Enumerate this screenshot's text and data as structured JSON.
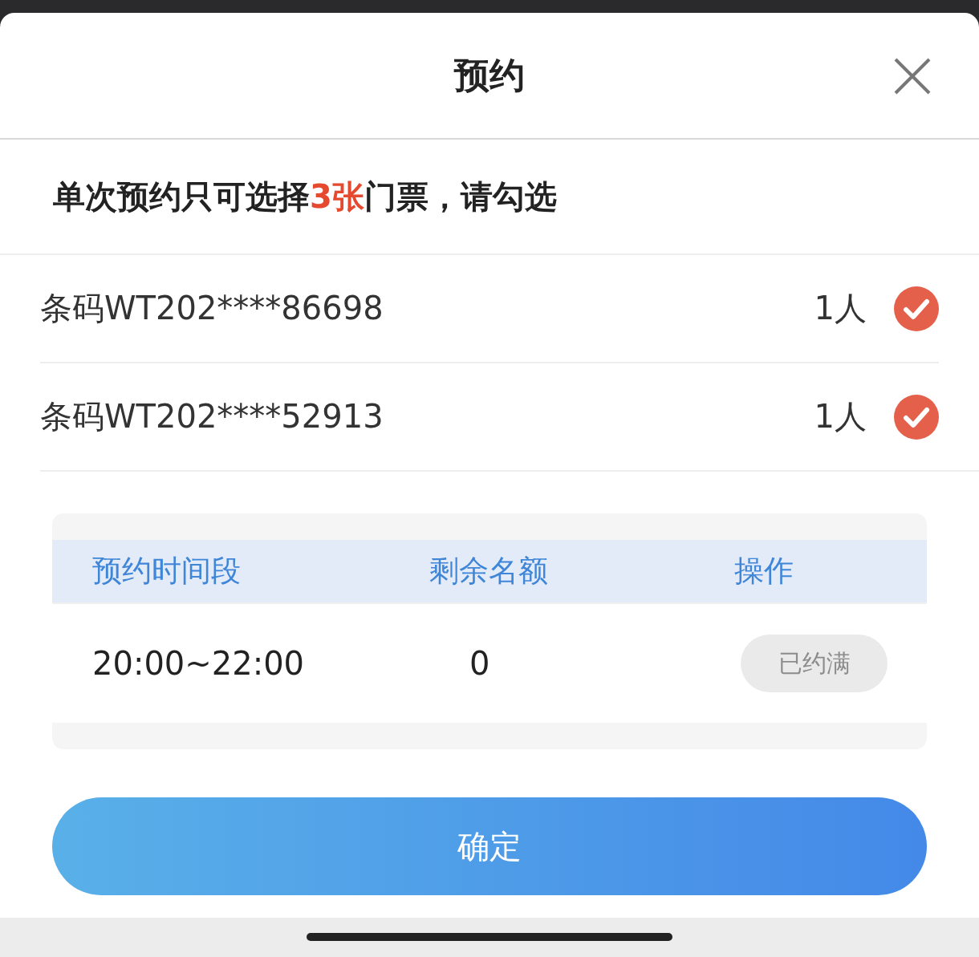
{
  "title": "预约",
  "notice": {
    "before": "单次预约只可选择",
    "highlight": "3张",
    "after": "门票，请勾选"
  },
  "tickets": [
    {
      "code": "条码WT202****86698",
      "people": "1人",
      "checked": true
    },
    {
      "code": "条码WT202****52913",
      "people": "1人",
      "checked": true
    }
  ],
  "table": {
    "columns": [
      "预约时间段",
      "剩余名额",
      "操作"
    ],
    "rows": [
      {
        "time": "20:00~22:00",
        "remaining": "0",
        "action": "已约满",
        "disabled": true
      }
    ]
  },
  "confirm": "确定"
}
